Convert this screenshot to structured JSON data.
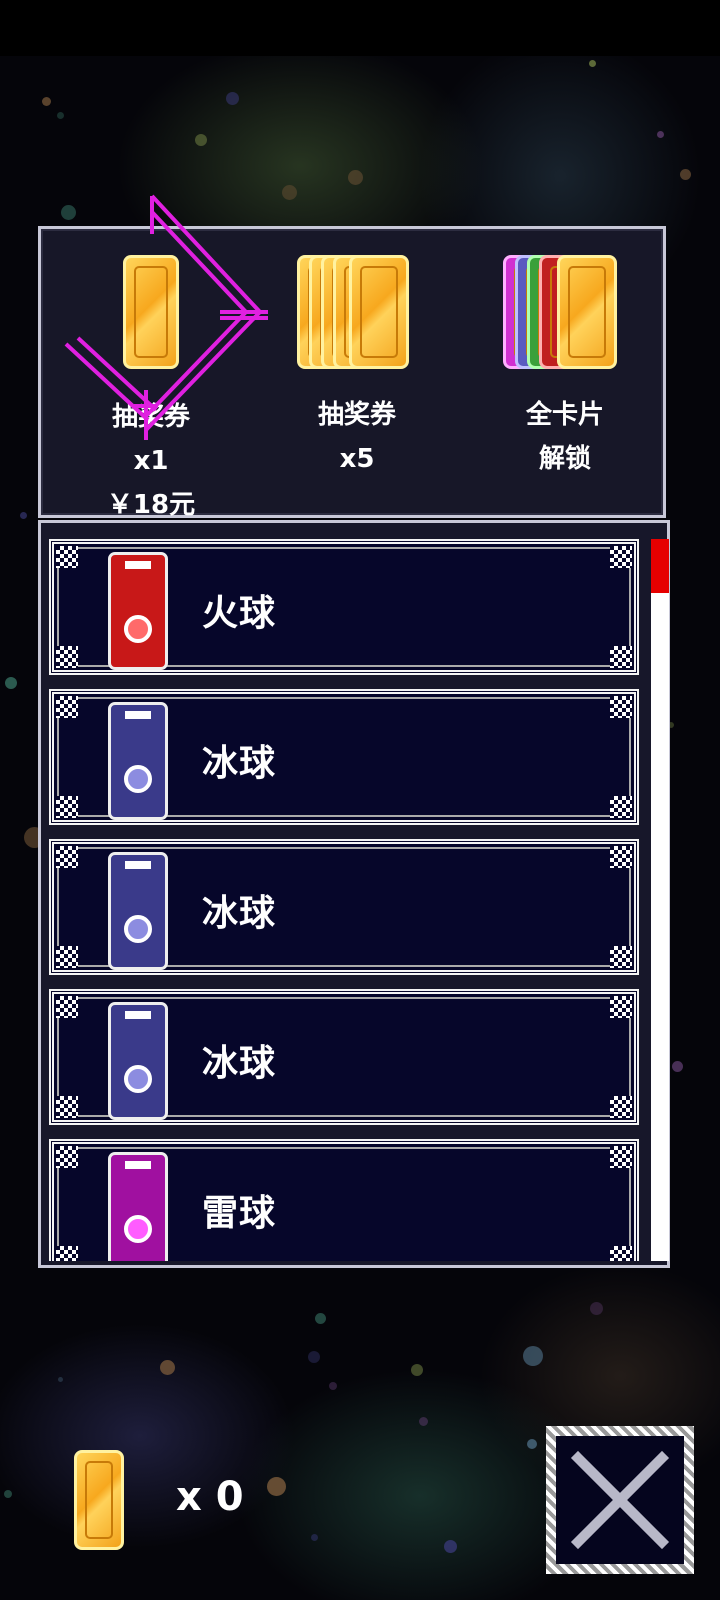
{
  "packages": [
    {
      "id": "single",
      "name": "抽奖券",
      "qty": "x1",
      "price": "￥18元"
    },
    {
      "id": "five",
      "name": "抽奖券",
      "qty": "x5"
    },
    {
      "id": "all",
      "line1": "全卡片",
      "line2": "解锁"
    }
  ],
  "cards": [
    {
      "name": "火球",
      "color": "#c81818",
      "accent": "#ff6a6a"
    },
    {
      "name": "冰球",
      "color": "#3a3a8a",
      "accent": "#8c8ce0"
    },
    {
      "name": "冰球",
      "color": "#3a3a8a",
      "accent": "#8c8ce0"
    },
    {
      "name": "冰球",
      "color": "#3a3a8a",
      "accent": "#8c8ce0"
    },
    {
      "name": "雷球",
      "color": "#a010a0",
      "accent": "#ff5cff"
    }
  ],
  "inventory": {
    "ticket_count": "x 0"
  },
  "colors": {
    "arrow": "#e020e0",
    "scroll_thumb": "#e60000",
    "ticket": "#f7a81e"
  },
  "icons": {
    "close": "close-icon",
    "ticket": "ticket-icon"
  }
}
